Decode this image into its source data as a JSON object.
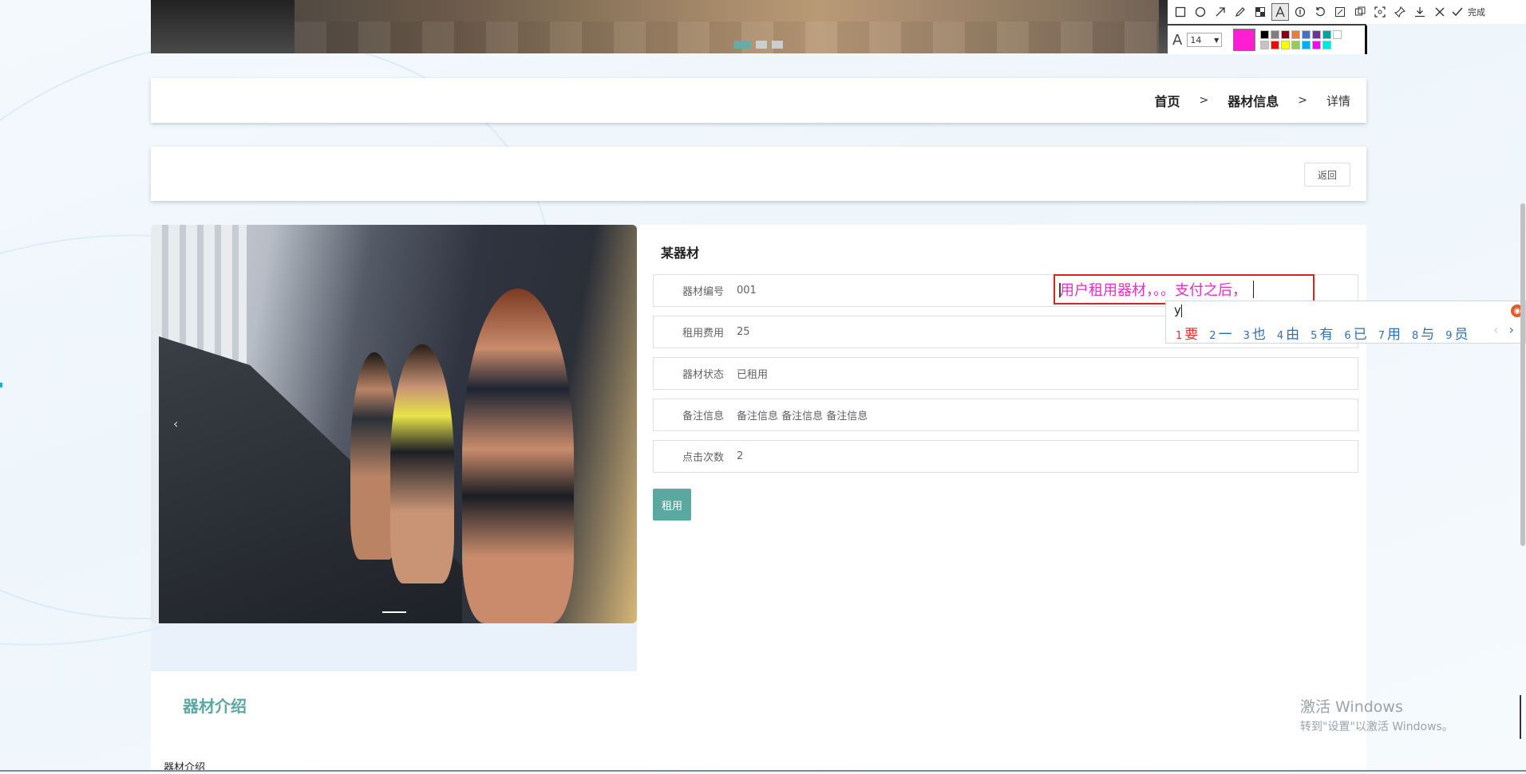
{
  "breadcrumb": {
    "home": "首页",
    "section": "器材信息",
    "separator": ">",
    "current": "详情"
  },
  "actions": {
    "back_label": "返回"
  },
  "detail": {
    "title": "某器材",
    "fields": [
      {
        "label": "器材编号",
        "value": "001"
      },
      {
        "label": "租用费用",
        "value": "25"
      },
      {
        "label": "器材状态",
        "value": "已租用"
      },
      {
        "label": "备注信息",
        "value": "备注信息 备注信息 备注信息"
      },
      {
        "label": "点击次数",
        "value": "2"
      }
    ],
    "rent_label": "租用"
  },
  "gallery": {
    "prev_arrow": "‹"
  },
  "intro": {
    "title": "器材介绍",
    "text": "器材介绍"
  },
  "annotation": {
    "text": "用户租用器材，。。支付之后，",
    "color": "#ff1ed2"
  },
  "ime": {
    "composition": "y",
    "candidates": [
      {
        "n": "1",
        "text": "要"
      },
      {
        "n": "2",
        "text": "一"
      },
      {
        "n": "3",
        "text": "也"
      },
      {
        "n": "4",
        "text": "由"
      },
      {
        "n": "5",
        "text": "有"
      },
      {
        "n": "6",
        "text": "已"
      },
      {
        "n": "7",
        "text": "用"
      },
      {
        "n": "8",
        "text": "与"
      },
      {
        "n": "9",
        "text": "员"
      }
    ],
    "prev": "‹",
    "next": "›"
  },
  "snip_tool": {
    "icons": [
      "rectangle-icon",
      "ellipse-icon",
      "arrow-icon",
      "pencil-icon",
      "mosaic-icon",
      "text-icon",
      "number-icon",
      "undo-icon",
      "pin-area-icon",
      "ocr-icon",
      "scan-icon",
      "pin-icon",
      "download-icon",
      "close-icon"
    ],
    "done_label": "完成",
    "font_size": "14",
    "current_color": "#ff1ed2",
    "palette": [
      "#000000",
      "#7f7f7f",
      "#880015",
      "#ed7d31",
      "#4472c4",
      "#7030a0",
      "#00a2a2",
      "#ffffff",
      "#c3c3c3",
      "#ff0000",
      "#ffff00",
      "#92d050",
      "#00b0f0",
      "#ff00ff",
      "#00e5e5"
    ]
  },
  "watermark": {
    "line1": "激活 Windows",
    "line2": "转到\"设置\"以激活 Windows。"
  }
}
